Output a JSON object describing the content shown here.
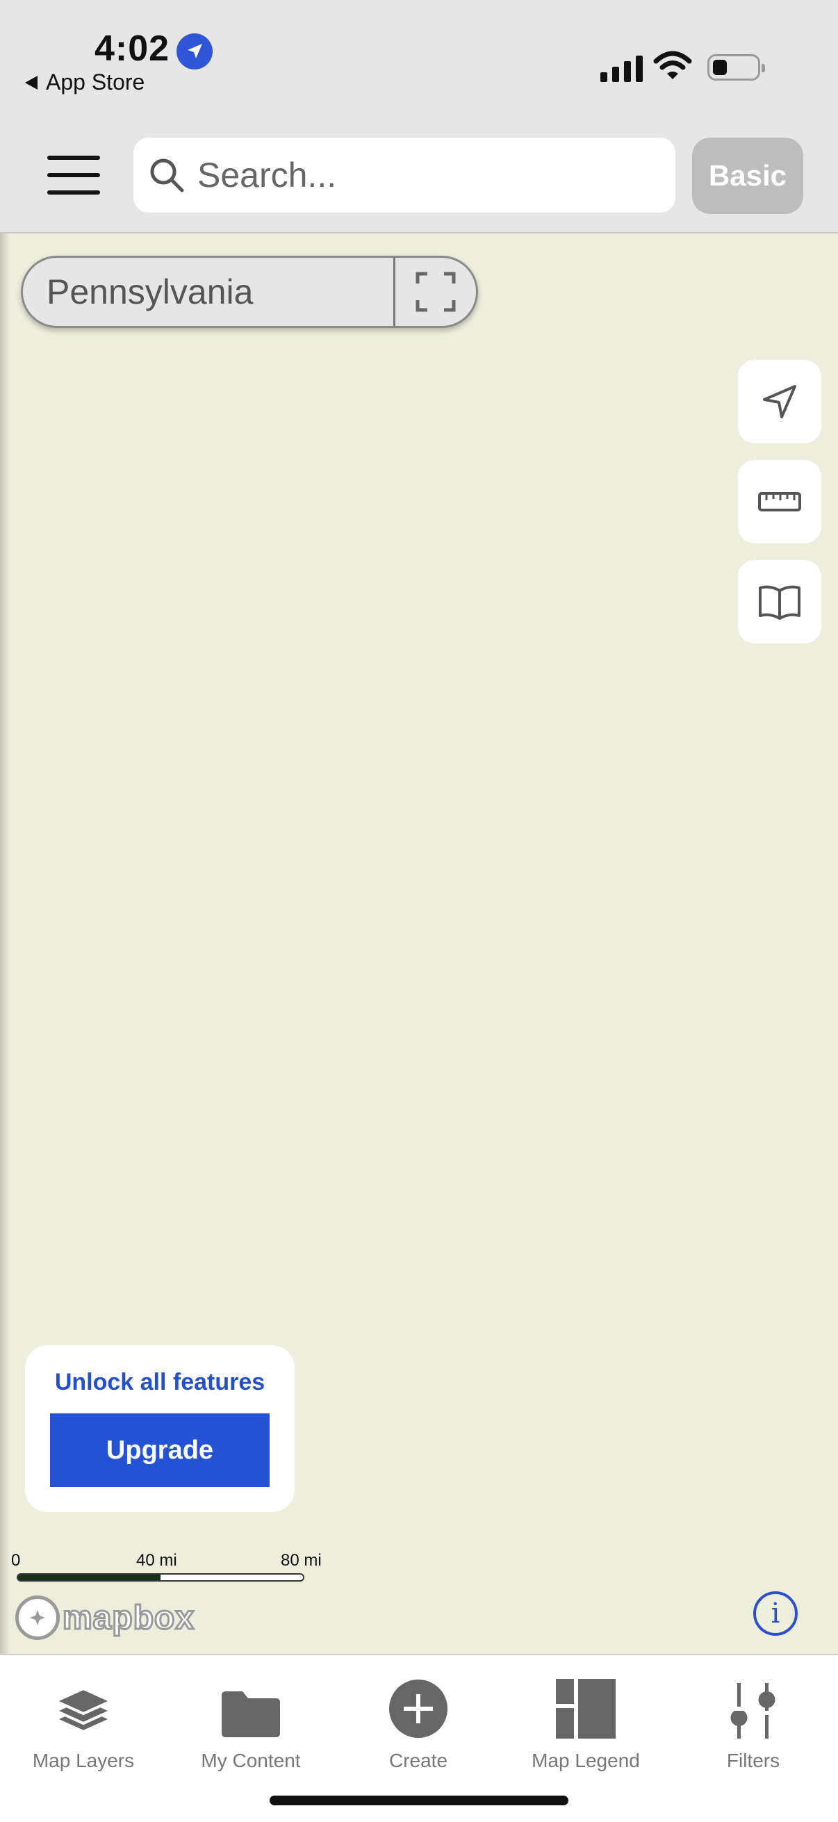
{
  "status_bar": {
    "time": "4:02",
    "back_label": "App Store"
  },
  "header": {
    "search_placeholder": "Search...",
    "plan_label": "Basic"
  },
  "map": {
    "region_name": "Pennsylvania",
    "background": "#edeedc"
  },
  "tools": [
    {
      "name": "locate-icon"
    },
    {
      "name": "ruler-icon"
    },
    {
      "name": "book-icon"
    }
  ],
  "upgrade": {
    "unlock_text": "Unlock all features",
    "button_label": "Upgrade",
    "accent": "#2352d4"
  },
  "scale": {
    "labels": [
      "0",
      "40 mi",
      "80 mi"
    ],
    "filled_fraction": 0.5
  },
  "attribution": {
    "logo_text": "mapbox",
    "info_glyph": "i"
  },
  "bottom_nav": [
    {
      "label": "Map Layers",
      "icon": "layers-icon"
    },
    {
      "label": "My Content",
      "icon": "folder-icon"
    },
    {
      "label": "Create",
      "icon": "plus-circle-icon"
    },
    {
      "label": "Map Legend",
      "icon": "legend-icon"
    },
    {
      "label": "Filters",
      "icon": "sliders-icon"
    }
  ]
}
